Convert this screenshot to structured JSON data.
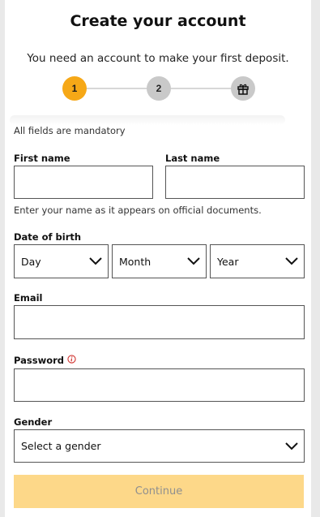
{
  "header": {
    "title": "Create your account",
    "subtitle": "You need an account to make your first deposit."
  },
  "stepper": {
    "steps": [
      {
        "label": "1",
        "state": "active"
      },
      {
        "label": "2",
        "state": "inactive"
      },
      {
        "label": "",
        "icon": "gift-icon",
        "state": "inactive"
      }
    ],
    "active_color": "#f6a817",
    "inactive_color": "#c9c9c9"
  },
  "form": {
    "mandatory_note": "All fields are mandatory",
    "first_name": {
      "label": "First name",
      "value": "",
      "placeholder": ""
    },
    "last_name": {
      "label": "Last name",
      "value": "",
      "placeholder": ""
    },
    "name_hint": "Enter your name as it appears on official documents.",
    "dob": {
      "label": "Date of birth",
      "day": "Day",
      "month": "Month",
      "year": "Year"
    },
    "email": {
      "label": "Email",
      "value": "",
      "placeholder": ""
    },
    "password": {
      "label": "Password",
      "value": "",
      "placeholder": "",
      "info_icon": "info-icon"
    },
    "gender": {
      "label": "Gender",
      "selected": "Select a gender"
    },
    "continue_label": "Continue",
    "continue_color": "#fdd889"
  }
}
